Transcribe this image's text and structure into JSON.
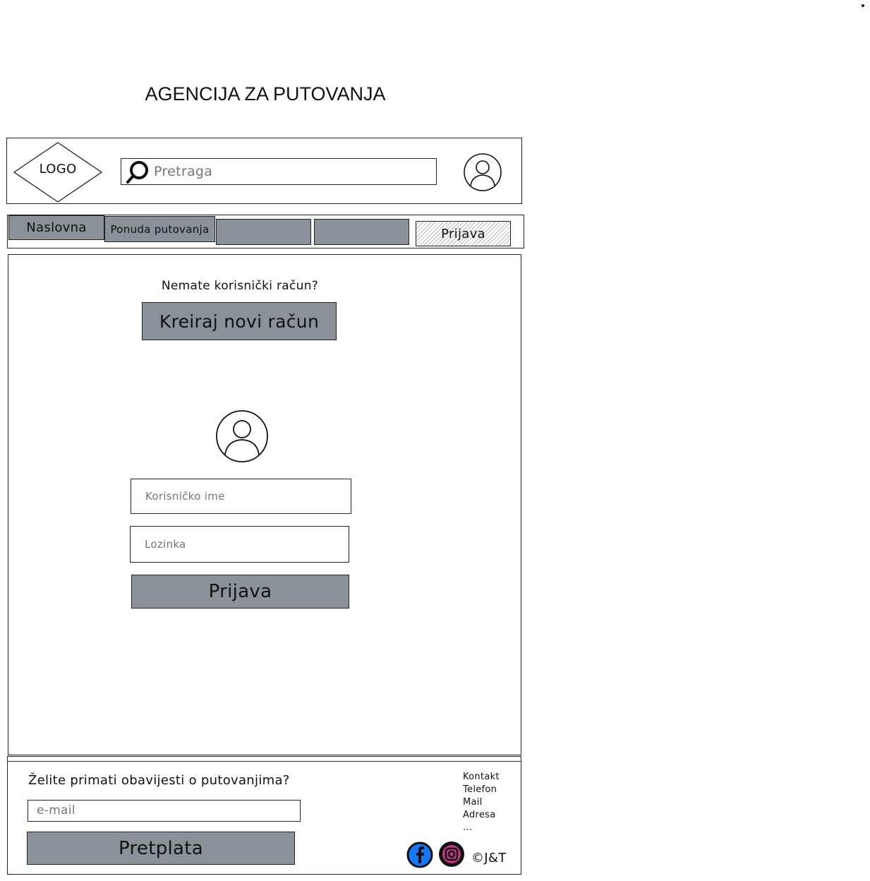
{
  "page": {
    "title": "AGENCIJA ZA PUTOVANJA"
  },
  "header": {
    "logo_label": "LOGO",
    "search_placeholder": "Pretraga"
  },
  "nav": {
    "items": [
      {
        "label": "Naslovna"
      },
      {
        "label": "Ponuda putovanja"
      },
      {
        "label": ""
      },
      {
        "label": ""
      },
      {
        "label": "Prijava"
      }
    ]
  },
  "main": {
    "no_account_text": "Nemate korisnički račun?",
    "create_account_button": "Kreiraj novi račun",
    "username_placeholder": "Korisničko ime",
    "password_placeholder": "Lozinka",
    "login_button": "Prijava"
  },
  "footer": {
    "newsletter_question": "Želite primati obavijesti o putovanjima?",
    "email_placeholder": "e-mail",
    "subscribe_button": "Pretplata",
    "contact_links": [
      "Kontakt",
      "Telefon",
      "Mail",
      "Adresa",
      "..."
    ],
    "copyright": "©J&T",
    "social": [
      {
        "icon": "facebook-icon",
        "color": "#1877f2"
      },
      {
        "icon": "instagram-icon",
        "color": "#c13584"
      }
    ]
  },
  "colors": {
    "button_gray": "#8a9199",
    "border": "#222222"
  }
}
